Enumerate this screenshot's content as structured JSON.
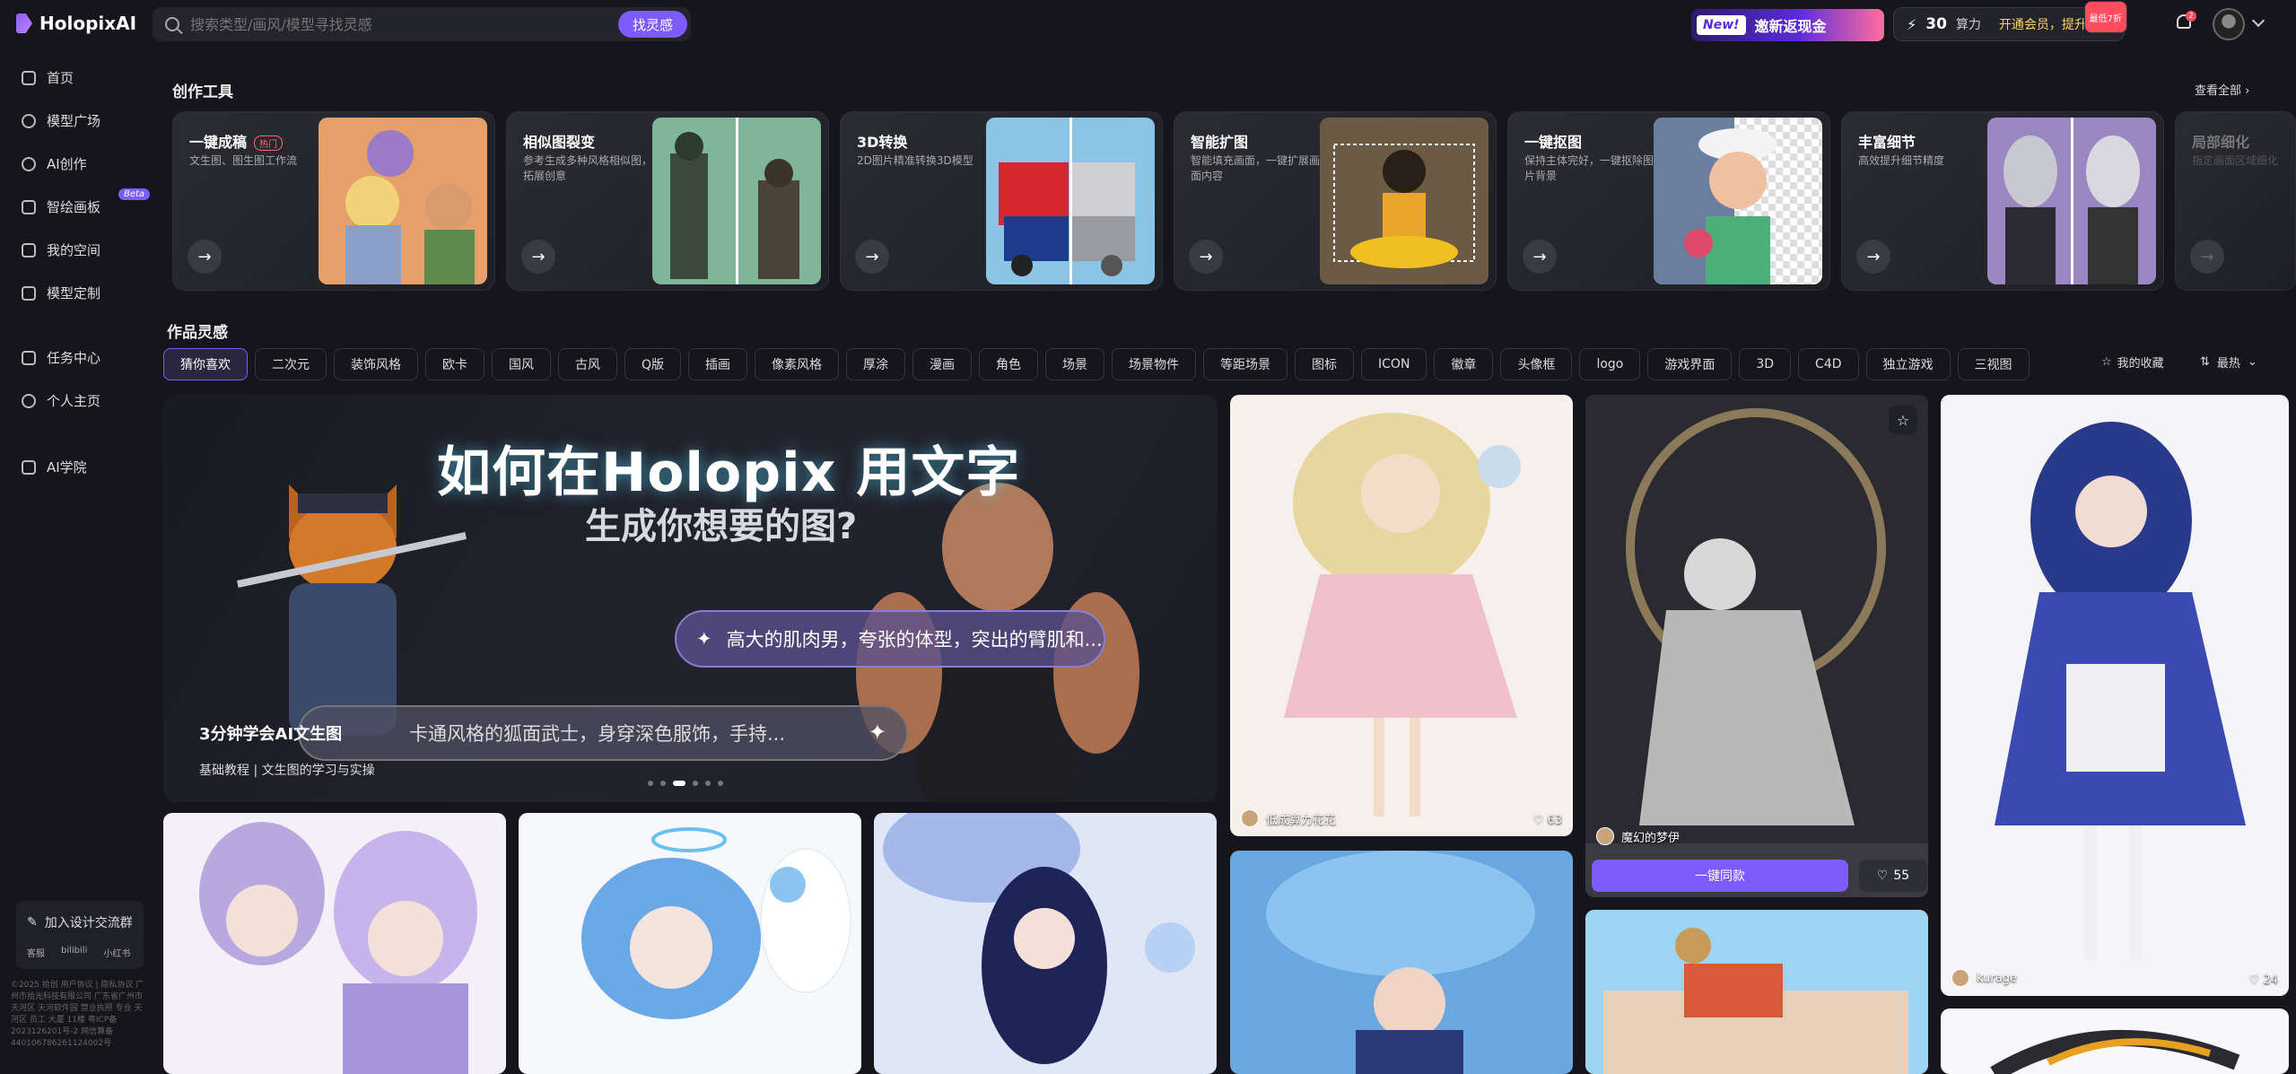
{
  "header": {
    "logo_text": "HolopixAI",
    "search_placeholder": "搜索类型/画风/模型寻找灵感",
    "find_button": "找灵感",
    "invite_new": "New!",
    "invite_text": "邀新返现金",
    "power_value": "30",
    "power_unit": "算力",
    "power_promo": "开通会员，提升算力",
    "power_tag": "最低7折",
    "bell_count": "2"
  },
  "sidebar": {
    "items": [
      {
        "label": "首页",
        "icon": "home-icon"
      },
      {
        "label": "模型广场",
        "icon": "compass-icon"
      },
      {
        "label": "AI创作",
        "icon": "sparkle-icon"
      },
      {
        "label": "智绘画板",
        "icon": "board-icon",
        "badge": "Beta"
      },
      {
        "label": "我的空间",
        "icon": "folder-icon"
      },
      {
        "label": "模型定制",
        "icon": "model-icon"
      },
      {
        "label": "任务中心",
        "icon": "task-icon"
      },
      {
        "label": "个人主页",
        "icon": "user-icon"
      },
      {
        "label": "AI学院",
        "icon": "academy-icon"
      }
    ],
    "community": "加入设计交流群",
    "community_links": [
      "客服",
      "bilibili",
      "小红书"
    ],
    "footer": "©2025 拾创 用户协议 | 隐私协议 广州市拾光科技有限公司 广东省广州市天河区 天河软件园 营业执照 专业 天河区 员工 大厦 11楼 粤ICP备2023126201号-2 网信算备 440106786261124002号"
  },
  "sections": {
    "tools_title": "创作工具",
    "view_all": "查看全部",
    "gallery_title": "作品灵感"
  },
  "tools": [
    {
      "title": "一键成稿",
      "hot": "热门",
      "desc": "文生图、图生图工作流"
    },
    {
      "title": "相似图裂变",
      "desc": "参考生成多种风格相似图，拓展创意"
    },
    {
      "title": "3D转换",
      "desc": "2D图片精准转换3D模型"
    },
    {
      "title": "智能扩图",
      "desc": "智能填充画面，一键扩展画面内容"
    },
    {
      "title": "一键抠图",
      "desc": "保持主体完好，一键抠除图片背景"
    },
    {
      "title": "丰富细节",
      "desc": "高效提升细节精度"
    },
    {
      "title": "局部细化",
      "desc": "指定画面区域细化"
    }
  ],
  "tags": [
    "猜你喜欢",
    "二次元",
    "装饰风格",
    "欧卡",
    "国风",
    "古风",
    "Q版",
    "插画",
    "像素风格",
    "厚涂",
    "漫画",
    "角色",
    "场景",
    "场景物件",
    "等距场景",
    "图标",
    "ICON",
    "徽章",
    "头像框",
    "logo",
    "游戏界面",
    "3D",
    "C4D",
    "独立游戏",
    "三视图"
  ],
  "filters": {
    "favorites": "我的收藏",
    "sort": "最热"
  },
  "banner": {
    "headline": "如何在Holopix 用文字",
    "subhead": "生成你想要的图?",
    "prompt1": "高大的肌肉男，夸张的体型，突出的臂肌和...",
    "prompt2": "卡通风格的狐面武士，身穿深色服饰，手持...",
    "title": "3分钟学会AI文生图",
    "subtitle": "基础教程 | 文生图的学习与实操"
  },
  "gallery": [
    {
      "user": "低成算力花花",
      "likes": "63"
    },
    {
      "user": "魔幻的梦伊",
      "likes": "55",
      "same_button": "一键同款"
    },
    {
      "user": "kurage",
      "likes": "24"
    }
  ],
  "colors": {
    "accent": "#7c5cff",
    "background": "#15151b",
    "card": "#23232b"
  }
}
